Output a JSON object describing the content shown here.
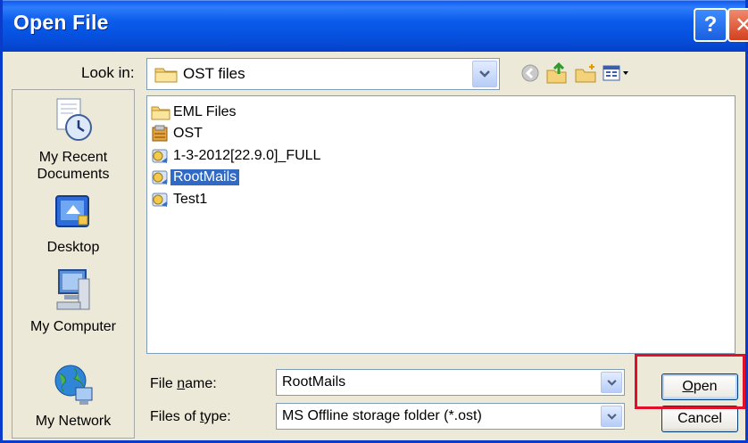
{
  "window": {
    "title": "Open File",
    "help_glyph": "?",
    "close_glyph": "✕"
  },
  "look_in": {
    "label": "Look in:",
    "value": "OST files"
  },
  "toolbar_icons": [
    "back-icon",
    "up-folder-icon",
    "new-folder-icon",
    "views-menu-icon"
  ],
  "places": [
    {
      "line1": "My Recent",
      "line2": "Documents",
      "icon": "recent-documents-icon"
    },
    {
      "line1": "Desktop",
      "line2": "",
      "icon": "desktop-icon"
    },
    {
      "line1": "My Computer",
      "line2": "",
      "icon": "my-computer-icon"
    },
    {
      "line1": "My Network",
      "line2": "",
      "icon": "my-network-icon"
    }
  ],
  "files": [
    {
      "name": "EML Files",
      "icon": "folder-icon",
      "selected": false
    },
    {
      "name": "OST",
      "icon": "ost-file-icon",
      "selected": false
    },
    {
      "name": "1-3-2012[22.9.0]_FULL",
      "icon": "mail-folder-icon",
      "selected": false
    },
    {
      "name": "RootMails",
      "icon": "mail-folder-icon",
      "selected": true
    },
    {
      "name": "Test1",
      "icon": "mail-folder-icon",
      "selected": false
    }
  ],
  "file_name": {
    "label_prefix": "File ",
    "label_u": "n",
    "label_suffix": "ame:",
    "value": "RootMails"
  },
  "file_type": {
    "label_prefix": "Files of ",
    "label_u": "t",
    "label_suffix": "ype:",
    "value": "MS Offline storage folder (*.ost)"
  },
  "buttons": {
    "open_u": "O",
    "open_rest": "pen",
    "cancel": "Cancel"
  },
  "colors": {
    "titlebar": "#0A56EF",
    "highlight": "#E0102A",
    "selection": "#316AC5",
    "dialog_bg": "#ECE9D8"
  }
}
